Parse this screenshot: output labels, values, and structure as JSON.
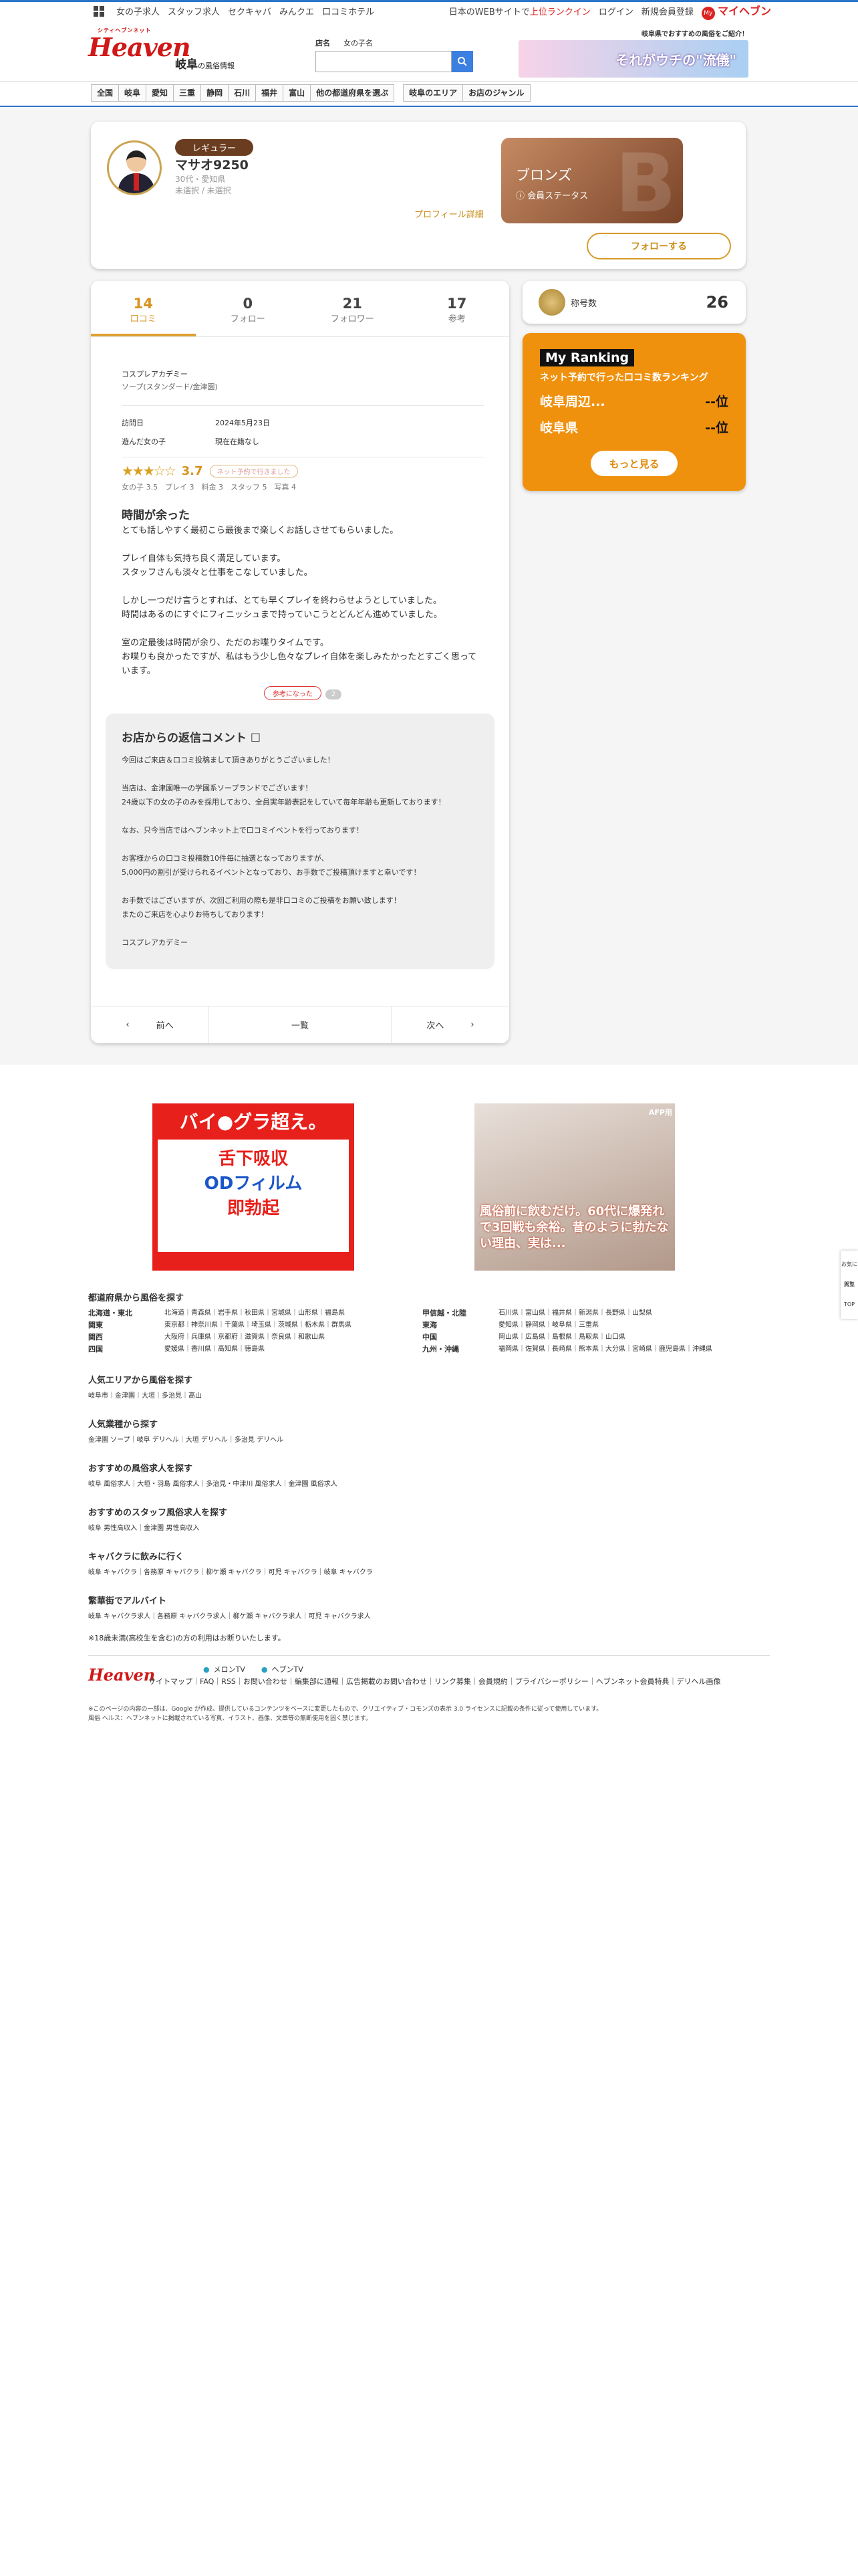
{
  "util": {
    "links": [
      "女の子求人",
      "スタッフ求人",
      "セクキャバ",
      "みんクエ",
      "口コミホテル"
    ],
    "notice_pre": "日本のWEBサイトで",
    "notice_hl": "上位ランクイン",
    "login": "ログイン",
    "register": "新規会員登録",
    "my_badge": "My",
    "my_heaven": "マイヘブン"
  },
  "header": {
    "logo_small": "シティヘブンネット",
    "logo": "Heaven",
    "region": "岐阜",
    "region_sub": "の風俗情報",
    "search_tabs": [
      "店名",
      "女の子名"
    ],
    "search_placeholder": "",
    "banner_tag": "岐阜県でおすすめの風俗をご紹介！",
    "banner_text": "それがウチの\"流儀\""
  },
  "nav": [
    "全国",
    "岐阜",
    "愛知",
    "三重",
    "静岡",
    "石川",
    "福井",
    "富山",
    "他の都道府県を選ぶ",
    "岐阜のエリア",
    "お店のジャンル"
  ],
  "profile": {
    "rank": "レギュラー",
    "name": "マサオ9250",
    "info1": "30代・愛知県",
    "info2": "未選択 / 未選択",
    "link": "プロフィール詳細",
    "status_title": "ブロンズ",
    "status_label": "会員ステータス",
    "status_bg": "B",
    "follow": "フォローする"
  },
  "tabs": [
    {
      "num": "14",
      "label": "口コミ"
    },
    {
      "num": "0",
      "label": "フォロー"
    },
    {
      "num": "21",
      "label": "フォロワー"
    },
    {
      "num": "17",
      "label": "参考"
    }
  ],
  "review": {
    "shop": "コスプレアカデミー",
    "shop_sub": "ソープ(スタンダード/金津園)",
    "visit_k": "訪問日",
    "visit_v": "2024年5月23日",
    "girl_k": "遊んだ女の子",
    "girl_v": "現在在籍なし",
    "stars": "★★★☆☆",
    "score": "3.7",
    "net": "ネット予約で行きました",
    "sub": "女の子 3.5　プレイ 3　料金 3　スタッフ 5　写真 4",
    "title": "時間が余った",
    "text": "とても話しやすく最初こら最後まで楽しくお話しさせてもらいました。\n\nプレイ自体も気持ち良く満足しています。\nスタッフさんも淡々と仕事をこなしていました。\n\nしかし一つだけ言うとすれば、とても早くプレイを終わらせようとしていました。\n時間はあるのにすぐにフィニッシュまで持っていこうとどんどん進めていました。\n\n室の定最後は時間が余り、ただのお喋りタイムです。\nお喋りも良かったですが、私はもう少し色々なプレイ自体を楽しみたかったとすごく思っています。",
    "helpful": "参考になった",
    "helpful_count": "2"
  },
  "reply": {
    "title": "お店からの返信コメント",
    "text": "今回はご来店＆口コミ投稿まして頂きありがとうございました！\n\n当店は、金津園唯一の学園系ソープランドでございます！\n24歳以下の女の子のみを採用しており、全員実年齢表記をしていて毎年年齢も更新しております！\n\nなお、只今当店ではヘブンネット上で口コミイベントを行っております！\n\nお客様からの口コミ投稿数10件毎に抽選となっておりますが、\n5,000円の割引が受けられるイベントとなっており、お手数でご投稿頂けますと幸いです！\n\nお手数ではございますが、次回ご利用の際も是非口コミのご投稿をお願い致します！\nまたのご来店を心よりお待ちしております！\n\nコスプレアカデミー"
  },
  "pager": {
    "prev": "前へ",
    "list": "一覧",
    "next": "次へ"
  },
  "medal": {
    "label": "称号数",
    "count": "26"
  },
  "myrank": {
    "title": "My Ranking",
    "sub": "ネット予約で行った口コミ数ランキング",
    "rows": [
      {
        "area": "岐阜周辺...",
        "pos": "--位"
      },
      {
        "area": "岐阜県",
        "pos": "--位"
      }
    ],
    "more": "もっと見る"
  },
  "ads": {
    "ad1_t1": "バイ●グラ超え。",
    "ad1_m1": "舌下吸収",
    "ad1_m2": "ODフィルム",
    "ad1_big": "即勃起",
    "ad2_tag": "AFP用",
    "ad2_text": "風俗前に飲むだけ。60代に爆発れで3回戦も余裕。昔のように勃たない理由、実は..."
  },
  "footer": {
    "pref_title": "都道府県から風俗を探す",
    "pref_left": [
      {
        "r": "北海道・東北",
        "p": "北海道｜青森県｜岩手県｜秋田県｜宮城県｜山形県｜福島県"
      },
      {
        "r": "関東",
        "p": "東京都｜神奈川県｜千葉県｜埼玉県｜茨城県｜栃木県｜群馬県"
      },
      {
        "r": "関西",
        "p": "大阪府｜兵庫県｜京都府｜滋賀県｜奈良県｜和歌山県"
      },
      {
        "r": "四国",
        "p": "愛媛県｜香川県｜高知県｜徳島県"
      }
    ],
    "pref_right": [
      {
        "r": "甲信越・北陸",
        "p": "石川県｜富山県｜福井県｜新潟県｜長野県｜山梨県"
      },
      {
        "r": "東海",
        "p": "愛知県｜静岡県｜岐阜県｜三重県"
      },
      {
        "r": "中国",
        "p": "岡山県｜広島県｜島根県｜鳥取県｜山口県"
      },
      {
        "r": "九州・沖縄",
        "p": "福岡県｜佐賀県｜長崎県｜熊本県｜大分県｜宮崎県｜鹿児島県｜沖縄県"
      }
    ],
    "sections": [
      {
        "t": "人気エリアから風俗を探す",
        "l": "岐阜市｜金津園｜大垣｜多治見｜高山"
      },
      {
        "t": "人気業種から探す",
        "l": "金津園 ソープ｜岐阜 デリヘル｜大垣 デリヘル｜多治見 デリヘル"
      },
      {
        "t": "おすすめの風俗求人を探す",
        "l": "岐阜 風俗求人｜大垣・羽島 風俗求人｜多治見・中津川 風俗求人｜金津園 風俗求人"
      },
      {
        "t": "おすすめのスタッフ風俗求人を探す",
        "l": "岐阜 男性高収入｜金津園 男性高収入"
      },
      {
        "t": "キャバクラに飲みに行く",
        "l": "岐阜 キャバクラ｜各務原 キャバクラ｜柳ケ瀬 キャバクラ｜可児 キャバクラ｜岐阜 キャバクラ"
      },
      {
        "t": "繁華街でアルバイト",
        "l": "岐阜 キャバクラ求人｜各務原 キャバクラ求人｜柳ケ瀬 キャバクラ求人｜可児 キャバクラ求人"
      }
    ],
    "notice": "※18歳未満(高校生を含む)の方の利用はお断りいたします。",
    "logo": "Heaven",
    "tv1": "メロンTV",
    "tv2": "ヘブンTV",
    "nav": "サイトマップ｜FAQ｜RSS｜お問い合わせ｜編集部に通報｜広告掲載のお問い合わせ｜リンク募集｜会員規約｜プライバシーポリシー｜ヘブンネット会員特典｜デリヘル画像",
    "copy1": "※このページの内容の一部は、Google が作成、提供しているコンテンツをベースに変更したもので、クリエイティブ・コモンズの表示 3.0 ライセンスに記載の条件に従って使用しています。",
    "copy2": "風俗 ヘルス：ヘブンネットに掲載されている写真、イラスト、画像、文章等の無断使用を固く禁じます。"
  },
  "side": [
    "お気に入り",
    "閲覧",
    "TOP"
  ]
}
